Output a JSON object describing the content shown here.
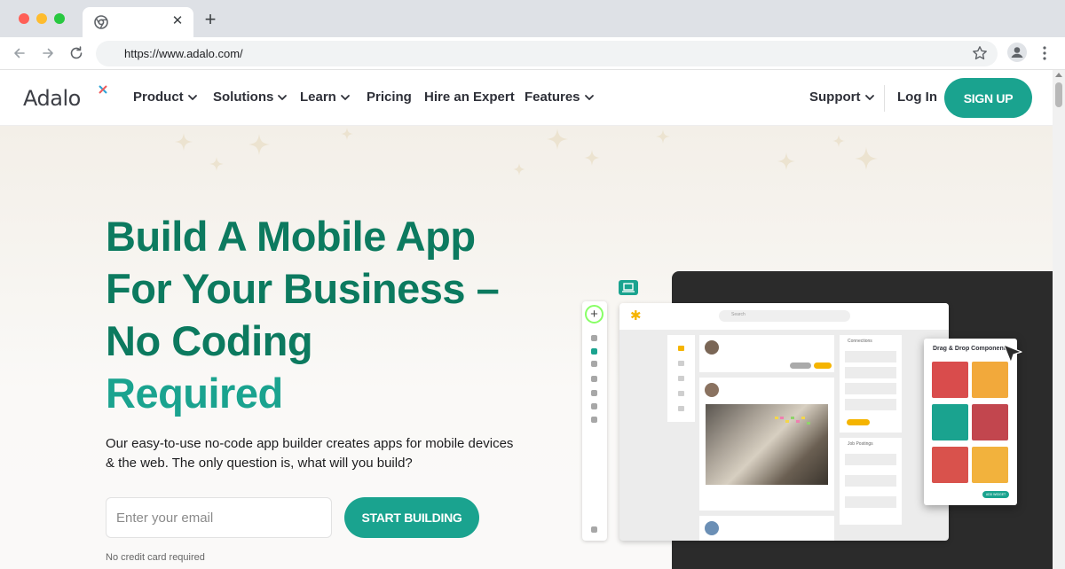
{
  "browser": {
    "tab_close": "✕",
    "new_tab": "+",
    "url": "https://www.adalo.com/"
  },
  "header": {
    "logo_text": "Adalo",
    "nav": [
      {
        "label": "Product",
        "dropdown": true
      },
      {
        "label": "Solutions",
        "dropdown": true
      },
      {
        "label": "Learn",
        "dropdown": true
      },
      {
        "label": "Pricing",
        "dropdown": false
      },
      {
        "label": "Hire an Expert",
        "dropdown": false
      },
      {
        "label": "Features",
        "dropdown": true
      }
    ],
    "support": "Support",
    "login": "Log In",
    "signup": "SIGN UP"
  },
  "hero": {
    "headline_line1": "Build A Mobile App",
    "headline_line2": "For Your Business –",
    "headline_line3": "No Coding",
    "headline_line4": "Required",
    "subtext": "Our easy-to-use no-code app builder creates apps for mobile devices & the web. The only question is, what will you build?",
    "email_placeholder": "Enter your email",
    "cta": "START BUILDING",
    "note": "No credit card required"
  },
  "illustration": {
    "search": "Search",
    "connections": "Connections",
    "job_postings": "Job Postings",
    "dnd_title": "Drag & Drop Components",
    "add_button": "ADD WIDGET"
  },
  "colors": {
    "brand": "#1aa38f",
    "headline": "#0c7a5f",
    "dark_panel": "#2b2b2b"
  }
}
